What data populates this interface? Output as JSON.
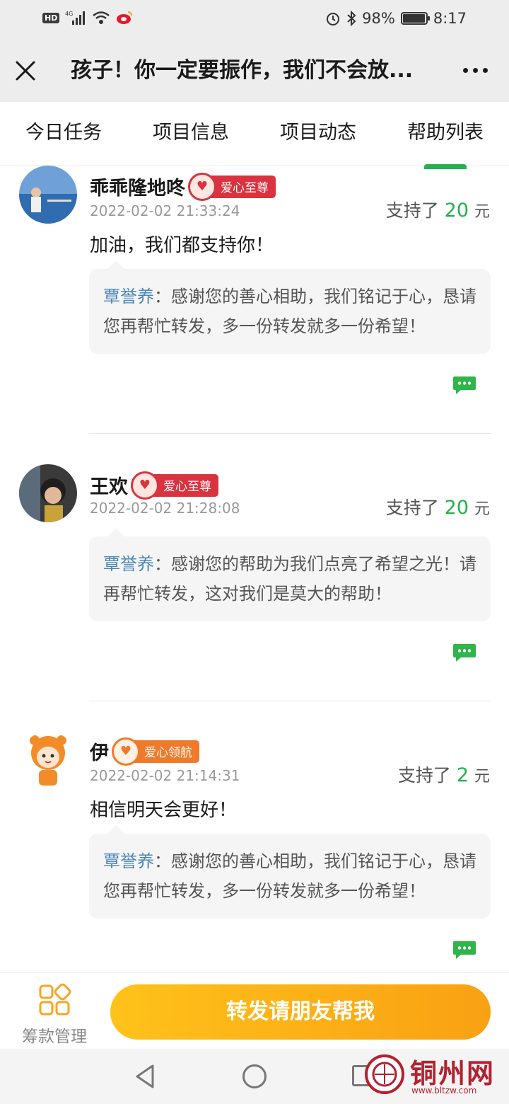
{
  "status_bar": {
    "hd": "HD",
    "network": "4G",
    "battery": "98%",
    "battery_level": 0.98,
    "time": "8:17"
  },
  "title_bar": {
    "title": "孩子！你一定要振作，我们不会放..."
  },
  "tabs": [
    {
      "label": "今日任务"
    },
    {
      "label": "项目信息"
    },
    {
      "label": "项目动态"
    },
    {
      "label": "帮助列表"
    }
  ],
  "active_tab_color": "#22b14c",
  "entries": [
    {
      "name": "乖乖隆地咚",
      "badge": "爱心至尊",
      "badge_color": "#d9333f",
      "time": "2022-02-02 21:33:24",
      "support_prefix": "支持了",
      "amount": "20",
      "unit": "元",
      "message": "加油，我们都支持你！",
      "reply_author": "覃誉养",
      "reply_sep": "：",
      "reply_text": "感谢您的善心相助，我们铭记于心，恳请您再帮忙转发，多一份转发就多一份希望！"
    },
    {
      "name": "王欢",
      "badge": "爱心至尊",
      "badge_color": "#d9333f",
      "time": "2022-02-02 21:28:08",
      "support_prefix": "支持了",
      "amount": "20",
      "unit": "元",
      "message": "",
      "reply_author": "覃誉养",
      "reply_sep": "：",
      "reply_text": "感谢您的帮助为我们点亮了希望之光！请再帮忙转发，这对我们是莫大的帮助！"
    },
    {
      "name": "伊",
      "badge": "爱心领航",
      "badge_color": "#f07a2a",
      "time": "2022-02-02 21:14:31",
      "support_prefix": "支持了",
      "amount": "2",
      "unit": "元",
      "message": "相信明天会更好！",
      "reply_author": "覃誉养",
      "reply_sep": "：",
      "reply_text": "感谢您的善心相助，我们铭记于心，恳请您再帮忙转发，多一份转发就多一份希望！"
    }
  ],
  "action_bar": {
    "manage_label": "筹款管理",
    "share_label": "转发请朋友帮我"
  },
  "watermark": {
    "name": "铜州网",
    "url": "www.bltzw.com"
  }
}
